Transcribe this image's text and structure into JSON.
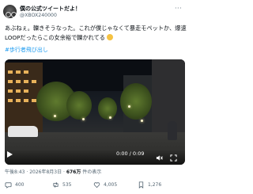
{
  "post": {
    "author_name": "僕の公式ツイートだよ！",
    "author_handle": "@XBOX240000",
    "text": "あぶねぇ。轢きそうなった。これが僕じゃなくて暴走モペットか、爆速LOOPだったらこの女余裕で轢かれてる",
    "hashtag": "#歩行者飛び出し",
    "timestamp": "午後8:43 · 2026年8月3日 · ",
    "views_count": "676万",
    "views_label": " 件の表示"
  },
  "video": {
    "time": "0:00 / 0:09"
  },
  "actions": {
    "reply_count": "400",
    "repost_count": "535",
    "like_count": "4,005",
    "bookmark_count": "1,276"
  },
  "icons": {
    "more": "more-icon",
    "play": "play-icon",
    "volume": "volume-icon",
    "fullscreen": "fullscreen-icon",
    "reply": "reply-icon",
    "repost": "repost-icon",
    "like": "like-icon",
    "bookmark": "bookmark-icon"
  },
  "colors": {
    "link": "#1d9bf0",
    "muted": "#536471",
    "text": "#0f1419"
  }
}
